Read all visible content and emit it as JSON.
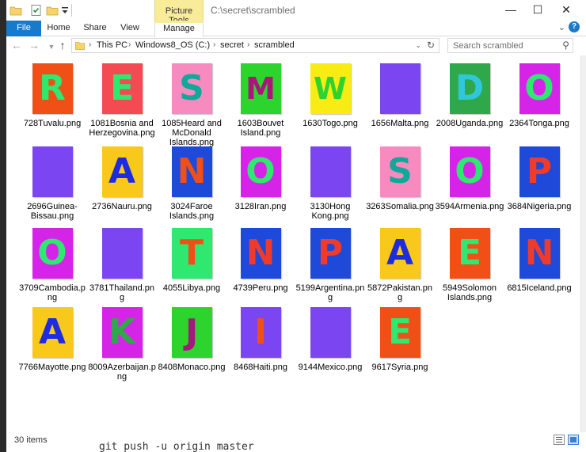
{
  "window": {
    "title": "C:\\secret\\scrambled",
    "context_tab": "Picture Tools",
    "minimize": "—",
    "maximize": "☐",
    "close": "✕"
  },
  "ribbon": {
    "tabs": [
      "File",
      "Home",
      "Share",
      "View",
      "Manage"
    ]
  },
  "address": {
    "crumbs": [
      "This PC",
      "Windows8_OS (C:)",
      "secret",
      "scrambled"
    ],
    "search_placeholder": "Search scrambled"
  },
  "files": [
    {
      "name": "728Tuvalu.png",
      "letter": "R",
      "bg": "#f04f16",
      "fg": "#2fe870"
    },
    {
      "name": "1081Bosnia and Herzegovina.png",
      "letter": "E",
      "bg": "#f44b53",
      "fg": "#2fe870"
    },
    {
      "name": "1085Heard and McDonald Islands.png",
      "letter": "S",
      "bg": "#f78bbf",
      "fg": "#0fa99a"
    },
    {
      "name": "1603Bouvet Island.png",
      "letter": "M",
      "bg": "#2dd42d",
      "fg": "#a8177a"
    },
    {
      "name": "1630Togo.png",
      "letter": "W",
      "bg": "#f8ec14",
      "fg": "#2dd42d"
    },
    {
      "name": "1656Malta.png",
      "letter": "",
      "bg": "#7b45f1",
      "fg": "#7b45f1"
    },
    {
      "name": "2008Uganda.png",
      "letter": "D",
      "bg": "#2fa74b",
      "fg": "#30c8d8"
    },
    {
      "name": "2364Tonga.png",
      "letter": "O",
      "bg": "#d524e8",
      "fg": "#2fe870"
    },
    {
      "name": "2696Guinea-Bissau.png",
      "letter": "",
      "bg": "#7b45f1",
      "fg": "#7b45f1"
    },
    {
      "name": "2736Nauru.png",
      "letter": "A",
      "bg": "#f8c81a",
      "fg": "#1e2be0"
    },
    {
      "name": "3024Faroe Islands.png",
      "letter": "N",
      "bg": "#1f49d8",
      "fg": "#f04f16"
    },
    {
      "name": "3128Iran.png",
      "letter": "O",
      "bg": "#d524e8",
      "fg": "#2fe870"
    },
    {
      "name": "3130Hong Kong.png",
      "letter": "",
      "bg": "#7b45f1",
      "fg": "#7b45f1"
    },
    {
      "name": "3263Somalia.png",
      "letter": "S",
      "bg": "#f78bbf",
      "fg": "#0fa99a"
    },
    {
      "name": "3594Armenia.png",
      "letter": "O",
      "bg": "#d524e8",
      "fg": "#2fe870"
    },
    {
      "name": "3684Nigeria.png",
      "letter": "P",
      "bg": "#1f49d8",
      "fg": "#f03a2a"
    },
    {
      "name": "3709Cambodia.png",
      "letter": "O",
      "bg": "#d524e8",
      "fg": "#2fe870"
    },
    {
      "name": "3781Thailand.png",
      "letter": "",
      "bg": "#7b45f1",
      "fg": "#7b45f1"
    },
    {
      "name": "4055Libya.png",
      "letter": "T",
      "bg": "#2fe870",
      "fg": "#f04f16"
    },
    {
      "name": "4739Peru.png",
      "letter": "N",
      "bg": "#1f49d8",
      "fg": "#f03a2a"
    },
    {
      "name": "5199Argentina.png",
      "letter": "P",
      "bg": "#1f49d8",
      "fg": "#f03a2a"
    },
    {
      "name": "5872Pakistan.png",
      "letter": "A",
      "bg": "#f8c81a",
      "fg": "#1e2be0"
    },
    {
      "name": "5949Solomon Islands.png",
      "letter": "E",
      "bg": "#f04f16",
      "fg": "#2fe870"
    },
    {
      "name": "6815Iceland.png",
      "letter": "N",
      "bg": "#1f49d8",
      "fg": "#f03a2a"
    },
    {
      "name": "7766Mayotte.png",
      "letter": "A",
      "bg": "#f8c81a",
      "fg": "#1e2be0"
    },
    {
      "name": "8009Azerbaijan.png",
      "letter": "K",
      "bg": "#d524e8",
      "fg": "#2fa74b"
    },
    {
      "name": "8408Monaco.png",
      "letter": "J",
      "bg": "#2dd42d",
      "fg": "#a8177a"
    },
    {
      "name": "8468Haiti.png",
      "letter": "I",
      "bg": "#7b45f1",
      "fg": "#f04f16"
    },
    {
      "name": "9144Mexico.png",
      "letter": "",
      "bg": "#7b45f1",
      "fg": "#7b45f1"
    },
    {
      "name": "9617Syria.png",
      "letter": "E",
      "bg": "#f04f16",
      "fg": "#2fe870"
    }
  ],
  "status": {
    "count": "30 items"
  },
  "background_text": "git push -u origin master"
}
